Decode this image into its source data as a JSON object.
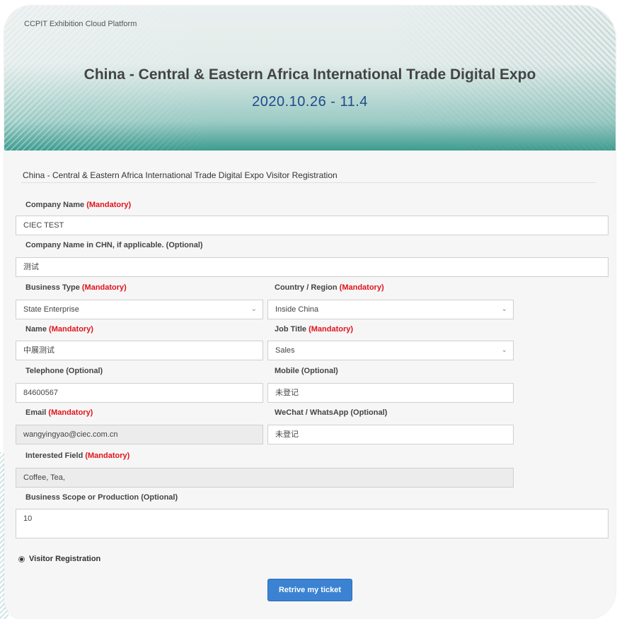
{
  "header": {
    "platform_name": "CCPIT Exhibition Cloud Platform",
    "expo_title": "China - Central & Eastern Africa International Trade Digital Expo",
    "expo_dates": "2020.10.26 - 11.4"
  },
  "form": {
    "heading": "China - Central & Eastern Africa International Trade Digital Expo Visitor Registration",
    "company_name": {
      "label": "Company Name ",
      "req": "(Mandatory)",
      "value": "CIEC TEST"
    },
    "company_name_chn": {
      "label": "Company Name in CHN, if applicable. (Optional)",
      "value": "测试"
    },
    "business_type": {
      "label": "Business Type ",
      "req": "(Mandatory)",
      "value": "State Enterprise"
    },
    "country_region": {
      "label": "Country / Region ",
      "req": "(Mandatory)",
      "value": "Inside China"
    },
    "name": {
      "label": "Name ",
      "req": "(Mandatory)",
      "value": "中展测试"
    },
    "job_title": {
      "label": "Job Title ",
      "req": "(Mandatory)",
      "value": "Sales"
    },
    "telephone": {
      "label": "Telephone (Optional)",
      "value": "84600567"
    },
    "mobile": {
      "label": "Mobile (Optional)",
      "value": "未登记"
    },
    "email": {
      "label": "Email ",
      "req": "(Mandatory)",
      "value": "wangyingyao@ciec.com.cn"
    },
    "wechat": {
      "label": "WeChat / WhatsApp (Optional)",
      "value": "未登记"
    },
    "interested_field": {
      "label": "Interested Field ",
      "req": "(Mandatory)",
      "value": "Coffee, Tea,"
    },
    "business_scope": {
      "label": "Business Scope or Production (Optional)",
      "value": "10"
    },
    "radio_label": "Visitor Registration",
    "submit_label": "Retrive my ticket",
    "select_arrow": "⌄"
  }
}
